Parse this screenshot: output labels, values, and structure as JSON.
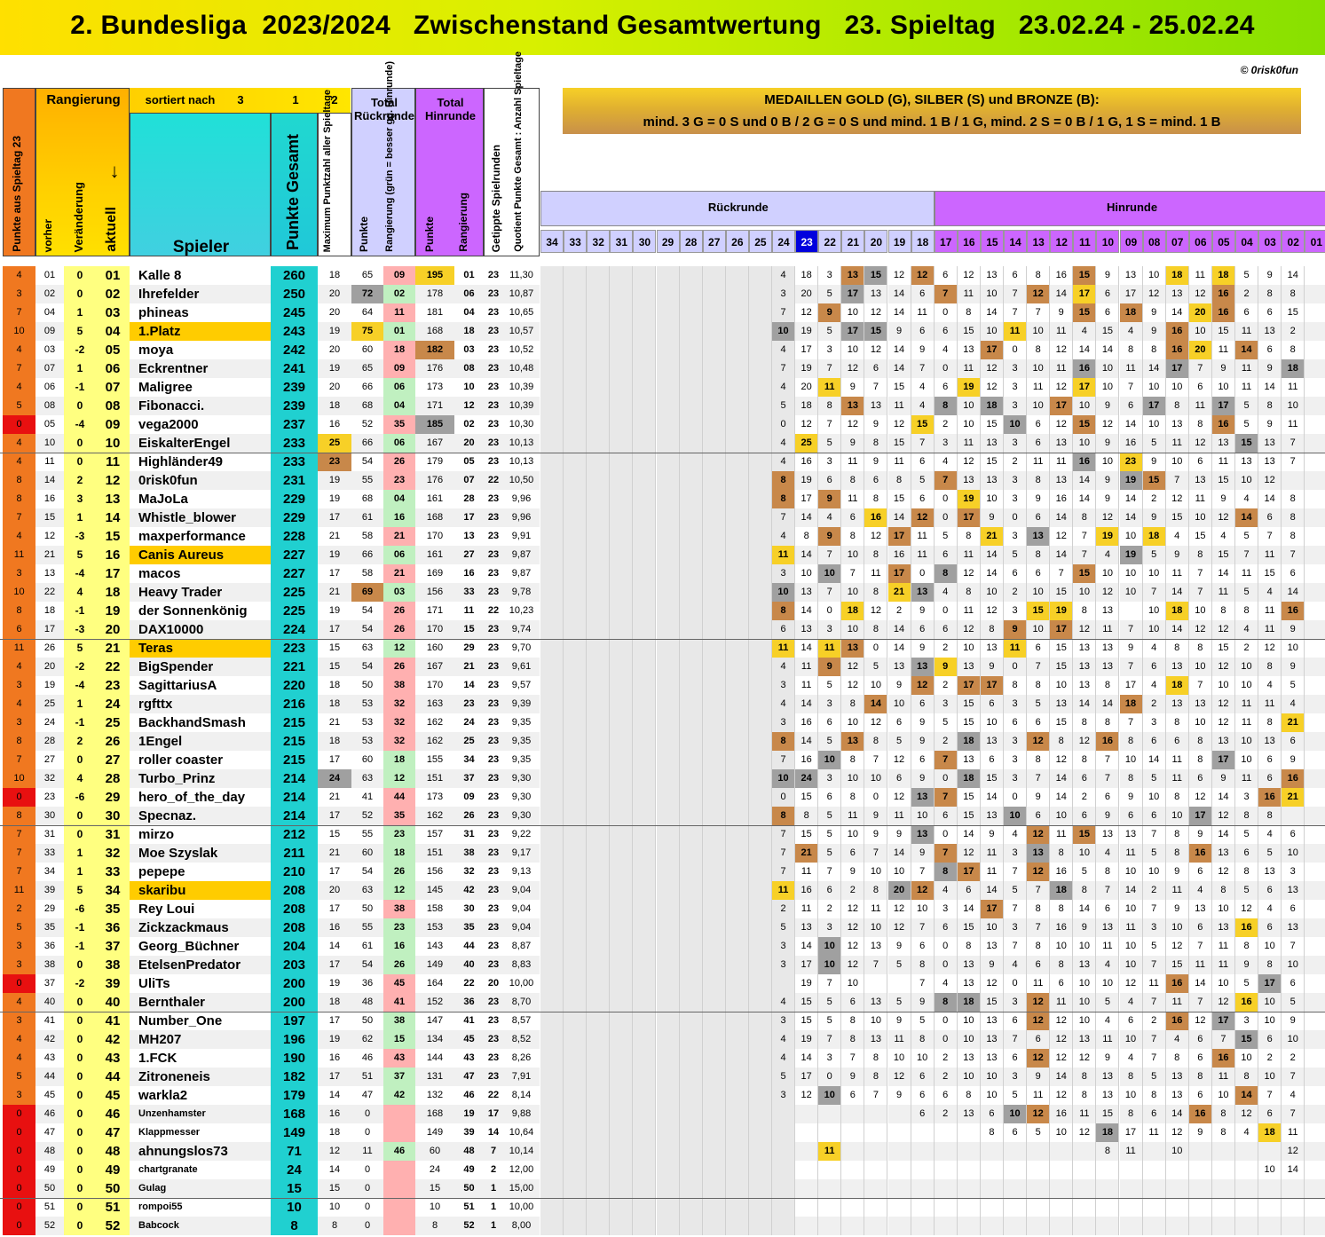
{
  "title": "2. Bundesliga  2023/2024   Zwischenstand Gesamtwertung   23. Spieltag   23.02.24 - 25.02.24",
  "credit": "© 0risk0fun",
  "medal": {
    "line1": "MEDAILLEN GOLD (G), SILBER (S) und BRONZE (B):",
    "line2": "mind. 3 G = 0 S und 0 B  /  2 G = 0 S und mind. 1 B  /  1 G, mind. 2 S = 0 B  /  1 G, 1 S = mind. 1 B"
  },
  "headers": {
    "punkte_spieltag": "Punkte aus Spieltag 23",
    "rangierung": "Rangierung",
    "sortiert": "sortiert nach",
    "sort1": "3",
    "sort2": "1",
    "sort3": "2",
    "vorher": "vorher",
    "veraenderung": "Veränderung",
    "aktuell": "aktuell",
    "arrow": "↓",
    "spieler": "Spieler",
    "punkte_gesamt": "Punkte Gesamt",
    "maximum": "Maximum Punktzahl aller Spieltage",
    "total_rr": "Total Rückrunde",
    "rr_punkte": "Punkte",
    "rr_rang": "Rangierung (grün = besser gg. Hinrunde)",
    "total_hr": "Total Hinrunde",
    "hr_punkte": "Punkte",
    "hr_rang": "Rangierung",
    "getippt": "Getippte Spielrunden",
    "quotient": "Quotient Punkte Gesamt : Anzahl Spieltage",
    "rueckrunde": "Rückrunde",
    "hinrunde": "Hinrunde"
  },
  "rounds": [
    "34",
    "33",
    "32",
    "31",
    "30",
    "29",
    "28",
    "27",
    "26",
    "25",
    "24",
    "23",
    "22",
    "21",
    "20",
    "19",
    "18",
    "17",
    "16",
    "15",
    "14",
    "13",
    "12",
    "11",
    "10",
    "09",
    "08",
    "07",
    "06",
    "05",
    "04",
    "03",
    "02",
    "01"
  ],
  "rows": [
    "4|01|0|01|Kalle 8|260|18|65|09|195|01|23|11,30|||||||||||4|18|3|13|15|12|12|6|12|13|6|8|16|15|9|13|10|18|11|18|5|9|14",
    "3|02|0|02|Ihrefelder|250|20|72|02|178|06|23|10,87|||||||||||3|20|5|17|13|14|6|7|11|10|7|12|14|17|6|17|12|13|12|16|2|8|8",
    "7|04|1|03|phineas|245|20|64|11|181|04|23|10,65|||||||||||7|12|9|10|12|14|11|0|8|14|7|7|9|15|6|18|9|14|20|16|6|6|15",
    "10|09|5|04|1.Platz|243|19|75|01|168|18|23|10,57|||||||||||10|19|5|17|15|9|6|6|15|10|11|10|11|4|15|4|9|16|10|15|11|13|2",
    "4|03|-2|05|moya|242|20|60|18|182|03|23|10,52|||||||||||4|17|3|10|12|14|9|4|13|17|0|8|12|14|14|8|8|16|20|11|14|6|8",
    "7|07|1|06|Eckrentner|241|19|65|09|176|08|23|10,48|||||||||||7|19|7|12|6|14|7|0|11|12|3|10|11|16|10|11|14|17|7|9|11|9|18",
    "4|06|-1|07|Maligree|239|20|66|06|173|10|23|10,39|||||||||||4|20|11|9|7|15|4|6|19|12|3|11|12|17|10|7|10|10|6|10|11|14|11",
    "5|08|0|08|Fibonacci.|239|18|68|04|171|12|23|10,39|||||||||||5|18|8|13|13|11|4|8|10|18|3|10|17|10|9|6|17|8|11|17|5|8|10",
    "0|05|-4|09|vega2000|237|16|52|35|185|02|23|10,30|||||||||||0|12|7|12|9|12|15|2|10|15|10|6|12|15|12|14|10|13|8|16|5|9|11",
    "4|10|0|10|EiskalterEngel|233|25|66|06|167|20|23|10,13|||||||||||4|25|5|9|8|15|7|3|11|13|3|6|13|10|9|16|5|11|12|13|15|13|7",
    "4|11|0|11|Highländer49|233|23|54|26|179|05|23|10,13|||||||||||4|16|3|11|9|11|6|4|12|15|2|11|11|16|10|23|9|10|6|11|13|13|7",
    "8|14|2|12|0risk0fun|231|19|55|23|176|07|22|10,50|||||||||||8|19|6|8|6|8|5|7|13|13|3|8|13|14|9|19|15|7|13|15|10|12|",
    "8|16|3|13|MaJoLa|229|19|68|04|161|28|23|9,96|||||||||||8|17|9|11|8|15|6|0|19|10|3|9|16|14|9|14|2|12|11|9|4|14|8",
    "7|15|1|14|Whistle_blower|229|17|61|16|168|17|23|9,96|||||||||||7|14|4|6|16|14|12|0|17|9|0|6|14|8|12|14|9|15|10|12|14|6|8",
    "4|12|-3|15|maxperformance|228|21|58|21|170|13|23|9,91|||||||||||4|8|9|8|12|17|11|5|8|21|3|13|12|7|19|10|18|4|15|4|5|7|8",
    "11|21|5|16|Canis Aureus|227|19|66|06|161|27|23|9,87|||||||||||11|14|7|10|8|16|11|6|11|14|5|8|14|7|4|19|5|9|8|15|7|11|7",
    "3|13|-4|17|macos|227|17|58|21|169|16|23|9,87|||||||||||3|10|10|7|11|17|0|8|12|14|6|6|7|15|10|10|10|11|7|14|11|15|6",
    "10|22|4|18|Heavy Trader|225|21|69|03|156|33|23|9,78|||||||||||10|13|7|10|8|21|13|4|8|10|2|10|15|10|12|10|7|14|7|11|5|4|14",
    "8|18|-1|19|der Sonnenkönig|225|19|54|26|171|11|22|10,23|||||||||||8|14|0|18|12|2|9|0|11|12|3|15|19|8|13||10|18|10|8|8|11|16",
    "6|17|-3|20|DAX10000|224|17|54|26|170|15|23|9,74|||||||||||6|13|3|10|8|14|6|6|12|8|9|10|17|12|11|7|10|14|12|12|4|11|9",
    "11|26|5|21|Teras|223|15|63|12|160|29|23|9,70|||||||||||11|14|11|13|0|14|9|2|10|13|11|6|15|13|13|9|4|8|8|15|2|12|10",
    "4|20|-2|22|BigSpender|221|15|54|26|167|21|23|9,61|||||||||||4|11|9|12|5|13|13|9|13|9|0|7|15|13|13|7|6|13|10|12|10|8|9",
    "3|19|-4|23|SagittariusA|220|18|50|38|170|14|23|9,57|||||||||||3|11|5|12|10|9|12|2|17|17|8|8|10|13|8|17|4|18|7|10|10|4|5",
    "4|25|1|24|rgfttx|216|18|53|32|163|23|23|9,39|||||||||||4|14|3|8|14|10|6|3|15|6|3|5|13|14|14|18|2|13|13|12|11|11|4",
    "3|24|-1|25|BackhandSmash|215|21|53|32|162|24|23|9,35|||||||||||3|16|6|10|12|6|9|5|15|10|6|6|15|8|8|7|3|8|10|12|11|8|21",
    "8|28|2|26|1Engel|215|18|53|32|162|25|23|9,35|||||||||||8|14|5|13|8|5|9|2|18|13|3|12|8|12|16|8|6|6|8|13|10|13|6",
    "7|27|0|27|roller coaster|215|17|60|18|155|34|23|9,35|||||||||||7|16|10|8|7|12|6|7|13|6|3|8|12|8|7|10|14|11|8|17|10|6|9",
    "10|32|4|28|Turbo_Prinz|214|24|63|12|151|37|23|9,30|||||||||||10|24|3|10|10|6|9|0|18|15|3|7|14|6|7|8|5|11|6|9|11|6|16",
    "0|23|-6|29|hero_of_the_day|214|21|41|44|173|09|23|9,30|||||||||||0|15|6|8|0|12|13|7|15|14|0|9|14|2|6|9|10|8|12|14|3|16|21",
    "8|30|0|30|Specnaz.|214|17|52|35|162|26|23|9,30|||||||||||8|8|5|11|9|11|10|6|15|13|10|6|10|6|9|6|6|10|17|12|8|8",
    "7|31|0|31|mirzo|212|15|55|23|157|31|23|9,22|||||||||||7|15|5|10|9|9|13|0|14|9|4|12|11|15|13|13|7|8|9|14|5|4|6",
    "7|33|1|32|Moe Szyslak|211|21|60|18|151|38|23|9,17|||||||||||7|21|5|6|7|14|9|7|12|11|3|13|8|10|4|11|5|8|16|13|6|5|10",
    "7|34|1|33|pepepe|210|17|54|26|156|32|23|9,13|||||||||||7|11|7|9|10|10|7|8|17|11|7|12|16|5|8|10|10|9|6|12|8|13|3",
    "11|39|5|34|skaribu|208|20|63|12|145|42|23|9,04|||||||||||11|16|6|2|8|20|12|4|6|14|5|7|18|8|7|14|2|11|4|8|5|6|13",
    "2|29|-6|35|Rey Loui|208|17|50|38|158|30|23|9,04|||||||||||2|11|2|12|11|12|10|3|14|17|7|8|8|14|6|10|7|9|13|10|12|4|6",
    "5|35|-1|36|Zickzackmaus|208|16|55|23|153|35|23|9,04|||||||||||5|13|3|12|10|12|7|6|15|10|3|7|16|9|13|11|3|10|6|13|16|6|13",
    "3|36|-1|37|Georg_Büchner|204|14|61|16|143|44|23|8,87|||||||||||3|14|10|12|13|9|6|0|8|13|7|8|10|10|11|10|5|12|7|11|8|10|7",
    "3|38|0|38|EtelsenPredator|203|17|54|26|149|40|23|8,83|||||||||||3|17|10|12|7|5|8|0|13|9|4|6|8|13|4|10|7|15|11|11|9|8|10",
    "0|37|-2|39|UliTs|200|19|36|45|164|22|20|10,00||||||||||||19|7|10|||7|4|13|12|0|11|6|10|10|12|11|16|14|10|5|17|6",
    "4|40|0|40|Bernthaler|200|18|48|41|152|36|23|8,70|||||||||||4|15|5|6|13|5|9|8|18|15|3|12|11|10|5|4|7|11|7|12|16|10|5",
    "3|41|0|41|Number_One|197|17|50|38|147|41|23|8,57|||||||||||3|15|5|8|10|9|5|0|10|13|6|12|12|10|4|6|2|16|12|17|3|10|9",
    "4|42|0|42|MH207|196|19|62|15|134|45|23|8,52|||||||||||4|19|7|8|13|11|8|0|10|13|7|6|12|13|11|10|7|4|6|7|15|6|10",
    "4|43|0|43|1.FCK|190|16|46|43|144|43|23|8,26|||||||||||4|14|3|7|8|10|10|2|13|13|6|12|12|12|9|4|7|8|6|16|10|2|2",
    "5|44|0|44|Zitroneneis|182|17|51|37|131|47|23|7,91|||||||||||5|17|0|9|8|12|6|2|10|10|3|9|14|8|13|8|5|13|8|11|8|10|7",
    "3|45|0|45|warkla2|179|14|47|42|132|46|22|8,14|||||||||||3|12|10|6|7|9|6|6|8|10|5|11|12|8|13|10|8|13|6|10|14|7|4",
    "0|46|0|46|Unzenhamster|168|16|0||168|19|17|9,88|||||||||||||||||6|2|13|6|10|12|16|11|15|8|6|14|16|8|12|6|7",
    "0|47|0|47|Klappmesser|149|18|0||149|39|14|10,64||||||||||||||||||||8|6|5|10|12|18|17|11|12|9|8|4|18|11",
    "0|48|0|48|ahnungslos73|71|12|11|46|60|48|7|10,14|||||||||||||11||||||||||||8|11||10|||||12||8|11",
    "0|49|0|49|chartgranate|24|14|0||24|49|2|12,00||||||||||||||||||||||||||||||||10|14|||",
    "0|50|0|50|Gulag|15|15|0||15|50|1|15,00|||||||||||||||||||||||||||||||||||15",
    "0|51|0|51|rompoi55|10|10|0||10|51|1|10,00|||||||||||||||||||||||||||||||||||10",
    "0|52|0|52|Babcock|8|8|0||8|52|1|8,00|||||||||||||||||||||||||||||||||||8"
  ],
  "colors": {
    "banner": "#c8f000",
    "orange": "#f07820",
    "red": "#e81010",
    "yellow_col": "#ffff80",
    "cyan": "#20d0d0",
    "lavender": "#d0d0ff",
    "violet": "#cc66ff",
    "highlight": "#ffcc00",
    "gold": "#f7d027",
    "silver": "#a0a0a0",
    "bronze": "#c8884a",
    "rank_red": "#ffb0b0",
    "rank_green": "#c0f0c0"
  }
}
